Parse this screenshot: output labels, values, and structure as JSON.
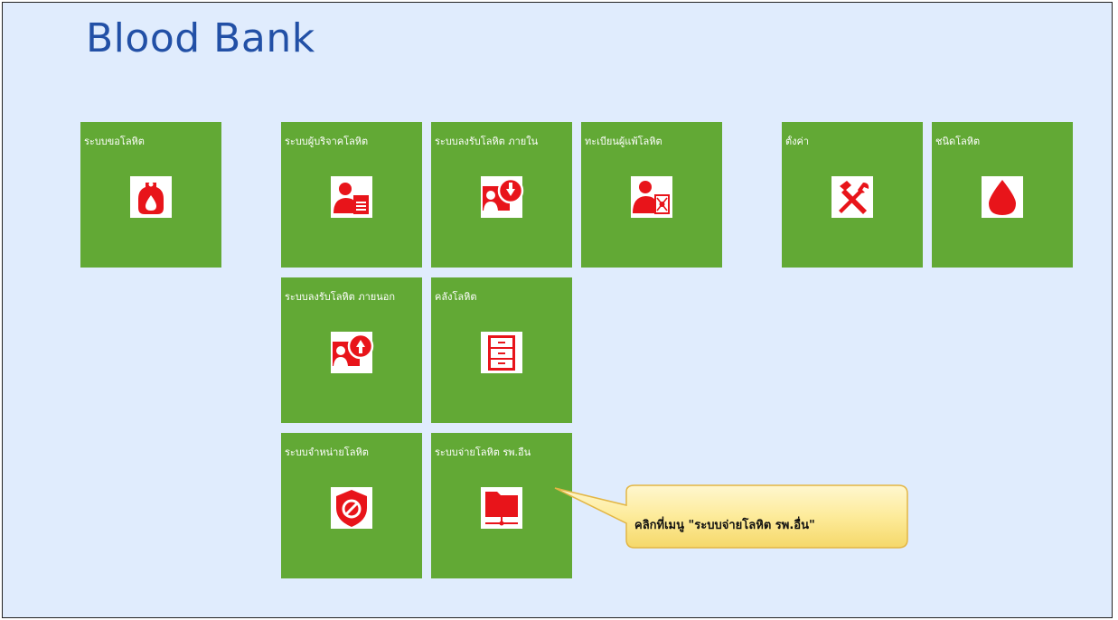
{
  "app": {
    "title": "Blood Bank"
  },
  "tiles": [
    {
      "label": "ระบบขอโลหิต",
      "icon": "blood-bag-icon"
    },
    {
      "label": "ระบบผู้บริจาคโลหิต",
      "icon": "donor-document-icon"
    },
    {
      "label": "ระบบลงรับโลหิต ภายใน",
      "icon": "receive-in-icon"
    },
    {
      "label": "ทะเบียนผู้แพ้โลหิต",
      "icon": "allergy-registry-icon"
    },
    {
      "label": "ตั้งค่า",
      "icon": "settings-tools-icon"
    },
    {
      "label": "ชนิดโลหิต",
      "icon": "blood-drop-icon"
    },
    {
      "label": "ระบบลงรับโลหิต ภายนอก",
      "icon": "receive-out-icon"
    },
    {
      "label": "คลังโลหิต",
      "icon": "cabinet-icon"
    },
    {
      "label": "ระบบจำหน่ายโลหิต",
      "icon": "prohibited-shield-icon"
    },
    {
      "label": "ระบบจ่ายโลหิต รพ.อื่น",
      "icon": "network-folder-icon"
    }
  ],
  "callout": {
    "text": "คลิกที่เมนู \"ระบบจ่ายโลหิต รพ.อื่น\""
  },
  "colors": {
    "tile": "#62a935",
    "icon": "#e8141a",
    "background": "#e0ecfd",
    "title": "#2250a6"
  }
}
